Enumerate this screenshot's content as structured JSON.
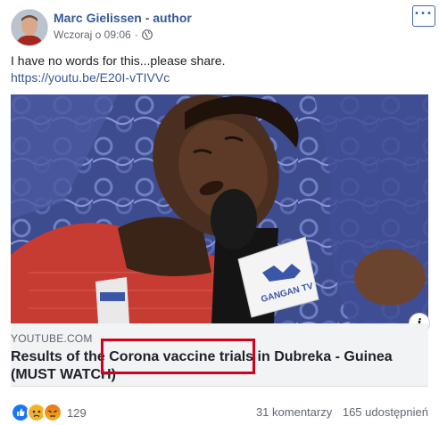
{
  "post": {
    "author": "Marc Gielissen - author",
    "timestamp": "Wczoraj o 09:06",
    "text": "I have no words for this...please share.",
    "link": "https://youtu.be/E20I-vTIVVc"
  },
  "preview": {
    "domain": "YOUTUBE.COM",
    "headline": "Results of the Corona vaccine trials in Dubreka - Guinea (MUST WATCH)",
    "highlighted_text": "Corona vaccine trials"
  },
  "video": {
    "mic_logo_text": "GANGAN TV"
  },
  "footer": {
    "reaction_count": "129",
    "comments": "31 komentarzy",
    "shares": "165 udostępnień"
  },
  "icons": {
    "reactions": [
      "like-icon",
      "sad-icon",
      "angry-icon"
    ],
    "privacy": "globe-icon",
    "menu": "more-options-icon",
    "info": "info-icon"
  },
  "colors": {
    "link": "#385898",
    "highlight_box": "#d0021b",
    "like": "#1877f2",
    "sad_angry": "#f7b125",
    "angry": "#e9710f"
  }
}
